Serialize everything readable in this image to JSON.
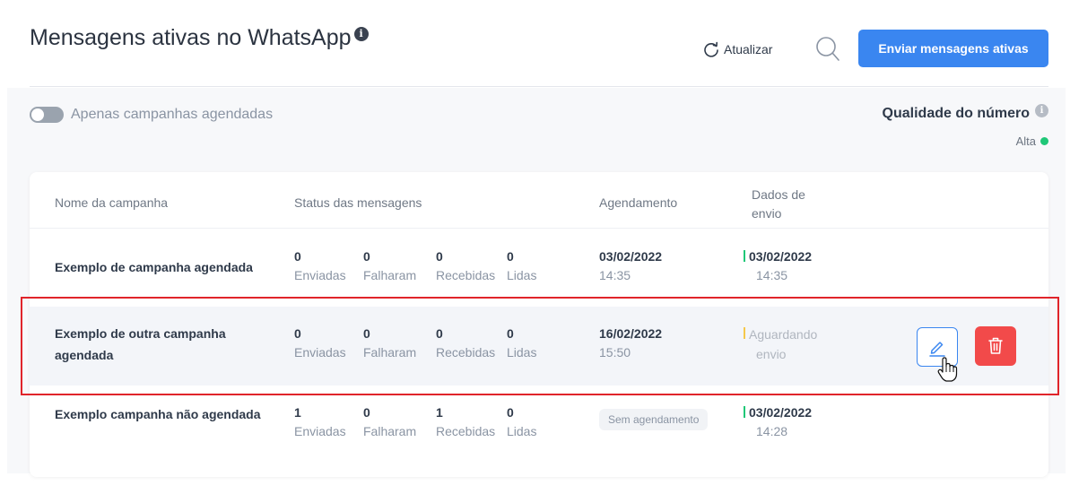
{
  "header": {
    "title": "Mensagens ativas no WhatsApp",
    "refresh_label": "Atualizar",
    "send_button_label": "Enviar mensagens ativas"
  },
  "filters": {
    "toggle_label": "Apenas campanhas agendadas",
    "toggle_on": false
  },
  "quality": {
    "label": "Qualidade do número",
    "value": "Alta",
    "status_color": "#1fc777"
  },
  "table": {
    "headers": {
      "name": "Nome da campanha",
      "status": "Status das mensagens",
      "schedule": "Agendamento",
      "send_data_line1": "Dados de",
      "send_data_line2": "envio"
    },
    "status_labels": [
      "Enviadas",
      "Falharam",
      "Recebidas",
      "Lidas"
    ],
    "rows": [
      {
        "name": "Exemplo de campanha agendada",
        "counts": [
          "0",
          "0",
          "0",
          "0"
        ],
        "schedule_date": "03/02/2022",
        "schedule_time": "14:35",
        "send_date": "03/02/2022",
        "send_time": "14:35"
      },
      {
        "name": "Exemplo de outra campanha agendada",
        "counts": [
          "0",
          "0",
          "0",
          "0"
        ],
        "schedule_date": "16/02/2022",
        "schedule_time": "15:50",
        "send_status_line1": "Aguardando",
        "send_status_line2": "envio"
      },
      {
        "name": "Exemplo campanha não agendada",
        "counts": [
          "1",
          "0",
          "1",
          "0"
        ],
        "schedule_badge": "Sem agendamento",
        "send_date": "03/02/2022",
        "send_time": "14:28"
      }
    ]
  },
  "colors": {
    "accent": "#3a86f0",
    "danger": "#f24a4a",
    "highlight_border": "#e0242a"
  }
}
